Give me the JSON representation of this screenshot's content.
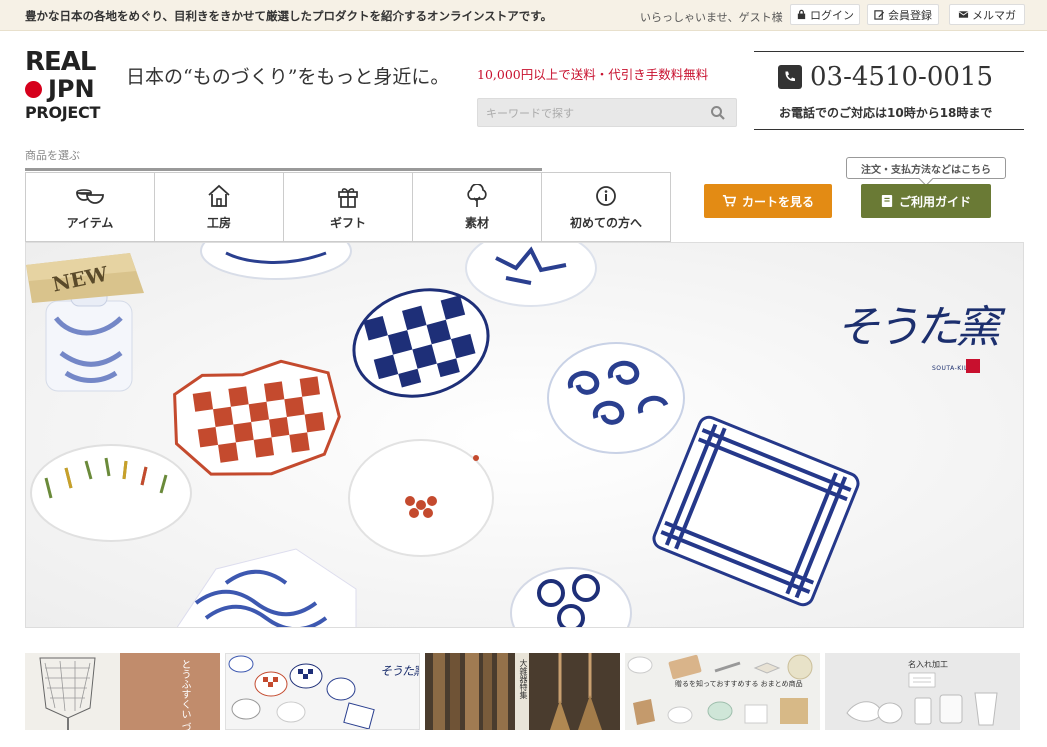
{
  "topbar": {
    "tagline": "豊かな日本の各地をめぐり、目利きをきかせて厳選したプロダクトを紹介するオンラインストアです。",
    "welcome": "いらっしゃいませ、ゲスト様",
    "login": "ログイン",
    "register": "会員登録",
    "newsletter": "メルマガ"
  },
  "logo": {
    "line1": "REAL",
    "line2": "JPN",
    "line3": "PROJECT"
  },
  "header": {
    "catch": "日本の“ものづくり”をもっと身近に。",
    "shipping": "10,000円以上で送料・代引き手数料無料",
    "search_placeholder": "キーワードで探す",
    "phone": "03-4510-0015",
    "hours": "お電話でのご対応は10時から18時まで"
  },
  "nav": {
    "label": "商品を選ぶ",
    "items": [
      {
        "label": "アイテム",
        "icon": "bowls-icon"
      },
      {
        "label": "工房",
        "icon": "house-icon"
      },
      {
        "label": "ギフト",
        "icon": "gift-icon"
      },
      {
        "label": "素材",
        "icon": "tree-icon"
      },
      {
        "label": "初めての方へ",
        "icon": "info-icon"
      }
    ]
  },
  "actions": {
    "cart": "カートを見る",
    "guide_bubble": "注文・支払方法などはこちら",
    "guide": "ご利用ガイド"
  },
  "hero": {
    "badge": "NEW",
    "brand": "そうた窯",
    "brand_sub": "SOUTA-KILN"
  },
  "banners": {
    "b1_text": "とうふすくい づくり体験",
    "b3_text": "大雑器特集",
    "b4_text": "贈るを知っておすすめする おまとめ商品",
    "b5_text": "名入れ加工"
  },
  "colors": {
    "topbar_bg": "#f6f1e6",
    "accent_red": "#c8102e",
    "cart_orange": "#e38b14",
    "guide_olive": "#6a7a35",
    "indigo": "#1c2f6e"
  }
}
